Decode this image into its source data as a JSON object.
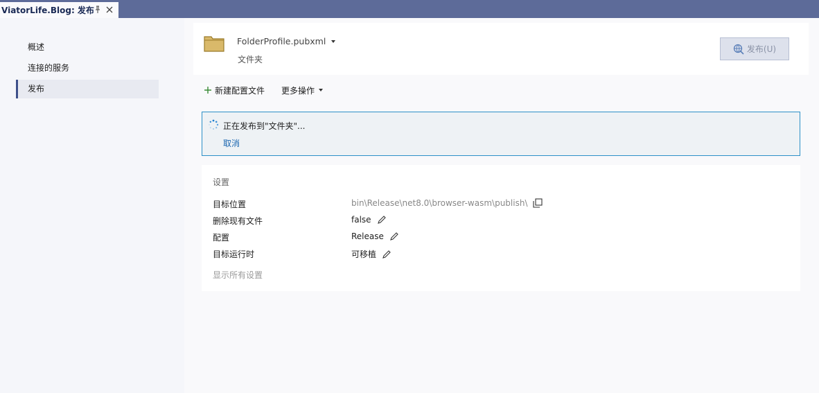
{
  "document_tab": {
    "title": "ViatorLife.Blog: 发布"
  },
  "sidebar": {
    "items": [
      {
        "label": "概述"
      },
      {
        "label": "连接的服务"
      },
      {
        "label": "发布"
      }
    ]
  },
  "profile": {
    "name": "FolderProfile.pubxml",
    "type": "文件夹",
    "publish_button": "发布(U)",
    "publish_button_enabled": false
  },
  "actions": {
    "new_profile": "新建配置文件",
    "more_actions": "更多操作"
  },
  "progress": {
    "message": "正在发布到\"文件夹\"...",
    "cancel": "取消"
  },
  "settings": {
    "title": "设置",
    "rows": [
      {
        "label": "目标位置",
        "value": "bin\\Release\\net8.0\\browser-wasm\\publish\\"
      },
      {
        "label": "删除现有文件",
        "value": "false"
      },
      {
        "label": "配置",
        "value": "Release"
      },
      {
        "label": "目标运行时",
        "value": "可移植"
      }
    ],
    "show_all": "显示所有设置"
  },
  "colors": {
    "titlebar": "#5d6b99",
    "accent": "#3d4f8a",
    "progress_border": "#2b8fc7",
    "link": "#1a66b0"
  }
}
